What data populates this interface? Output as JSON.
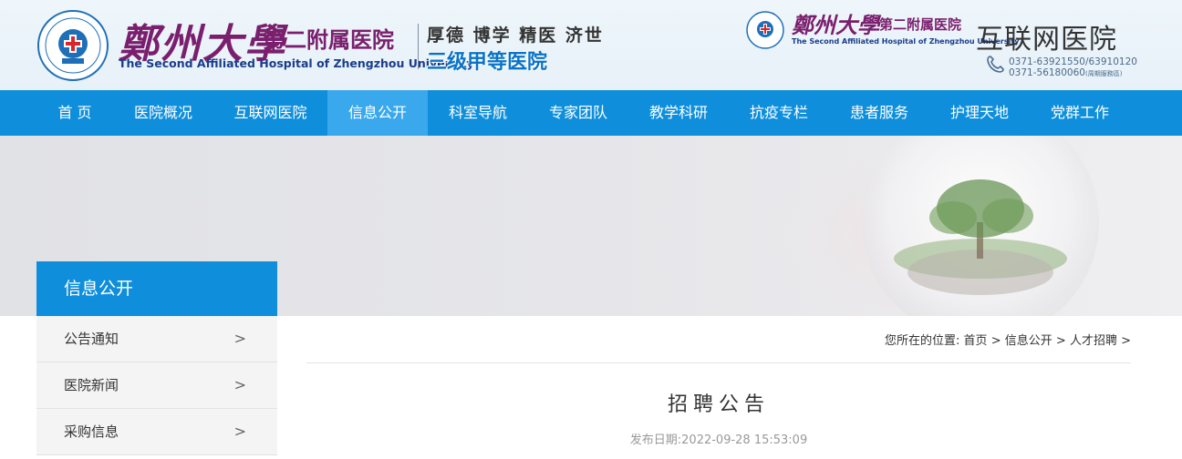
{
  "header": {
    "brand_cn": "鄭州大學",
    "brand_sub": "第二附属医院",
    "brand_en": "The Second Affiliated Hospital of Zhengzhou University",
    "motto": "厚德 博学 精医 济世",
    "grade": "三级甲等医院",
    "right": {
      "brand_cn": "鄭州大學",
      "brand_sub": "第二附属医院",
      "brand_en": "The Second Affiliated Hospital of Zhengzhou University",
      "internet_hospital": "互联网医院",
      "phone1": "0371-63921550/63910120",
      "phone2": "0371-56180060",
      "phone_note": "(周期服務區)"
    }
  },
  "nav": {
    "items": [
      {
        "label": "首 页"
      },
      {
        "label": "医院概况"
      },
      {
        "label": "互联网医院"
      },
      {
        "label": "信息公开"
      },
      {
        "label": "科室导航"
      },
      {
        "label": "专家团队"
      },
      {
        "label": "教学科研"
      },
      {
        "label": "抗疫专栏"
      },
      {
        "label": "患者服务"
      },
      {
        "label": "护理天地"
      },
      {
        "label": "党群工作"
      }
    ],
    "active_index": 3
  },
  "sidebar": {
    "title": "信息公开",
    "items": [
      {
        "label": "公告通知",
        "arrow": ">"
      },
      {
        "label": "医院新闻",
        "arrow": ">"
      },
      {
        "label": "采购信息",
        "arrow": ">"
      }
    ]
  },
  "breadcrumb": {
    "prefix": "您所在的位置:",
    "home": "首页",
    "sep1": ">",
    "section": "信息公开",
    "sep2": ">",
    "current": "人才招聘",
    "sep3": ">"
  },
  "article": {
    "title": "招聘公告",
    "date_label": "发布日期:",
    "date": "2022-09-28 15:53:09"
  },
  "colors": {
    "nav_bg": "#0f8fdb",
    "nav_active": "#3aa8ec",
    "brand_purple": "#7a1f6d",
    "brand_blue": "#1a3d8a"
  }
}
